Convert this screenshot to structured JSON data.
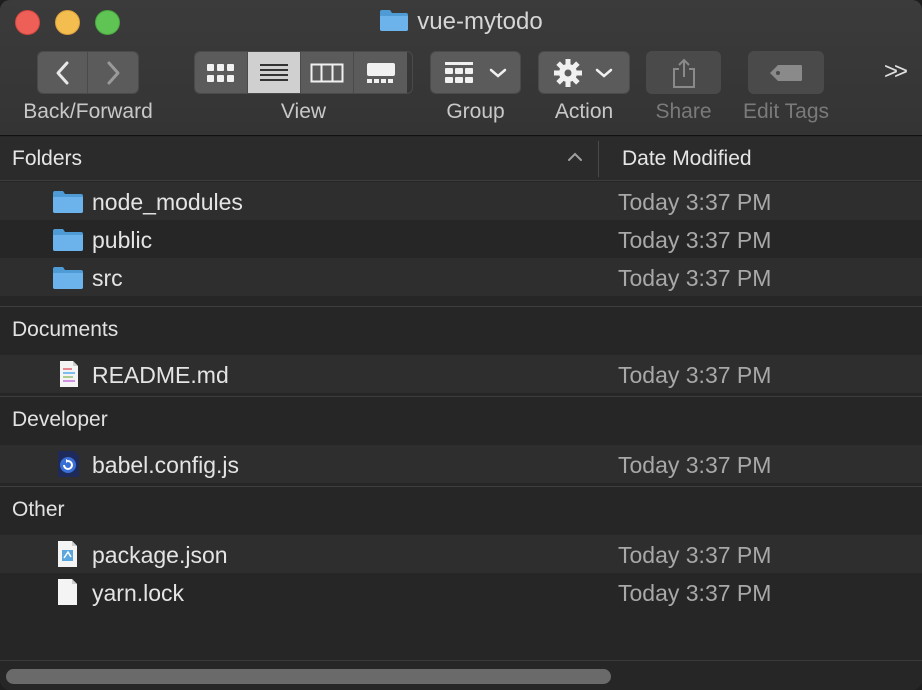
{
  "window": {
    "title": "vue-mytodo"
  },
  "toolbar": {
    "back_forward_label": "Back/Forward",
    "view_label": "View",
    "group_label": "Group",
    "action_label": "Action",
    "share_label": "Share",
    "edit_tags_label": "Edit Tags",
    "overflow_label": ">>"
  },
  "columns": {
    "name_header": "Folders",
    "date_header": "Date Modified"
  },
  "groups": {
    "folders": {
      "items": [
        {
          "name": "node_modules",
          "date": "Today 3:37 PM",
          "icon": "folder-icon"
        },
        {
          "name": "public",
          "date": "Today 3:37 PM",
          "icon": "folder-icon"
        },
        {
          "name": "src",
          "date": "Today 3:37 PM",
          "icon": "folder-icon"
        }
      ]
    },
    "documents": {
      "title": "Documents",
      "items": [
        {
          "name": "README.md",
          "date": "Today 3:37 PM",
          "icon": "markdown-file-icon"
        }
      ]
    },
    "developer": {
      "title": "Developer",
      "items": [
        {
          "name": "babel.config.js",
          "date": "Today 3:37 PM",
          "icon": "javascript-file-icon"
        }
      ]
    },
    "other": {
      "title": "Other",
      "items": [
        {
          "name": "package.json",
          "date": "Today 3:37 PM",
          "icon": "json-file-icon"
        },
        {
          "name": "yarn.lock",
          "date": "Today 3:37 PM",
          "icon": "blank-file-icon"
        }
      ]
    }
  },
  "colors": {
    "folder_blue": "#5aa7e0",
    "close": "#ee5f57",
    "minimize": "#f4bd4f",
    "zoom": "#5fc454"
  }
}
